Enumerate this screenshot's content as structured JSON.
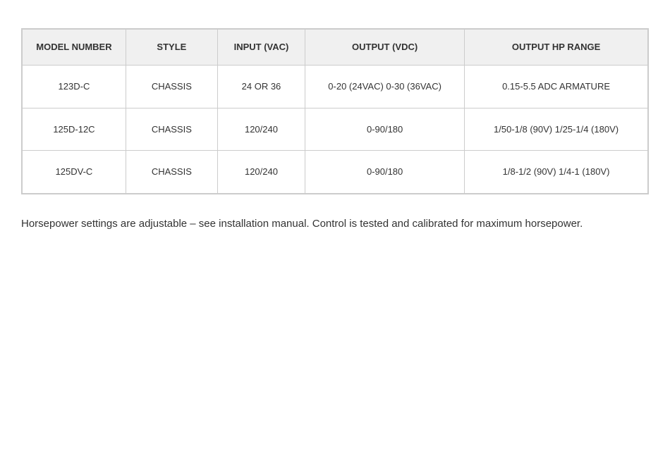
{
  "table": {
    "headers": {
      "model_number": "MODEL NUMBER",
      "style": "STYLE",
      "input_vac": "INPUT (VAC)",
      "output_vdc": "OUTPUT (VDC)",
      "output_hp_range": "OUTPUT HP RANGE"
    },
    "rows": [
      {
        "model": "123D-C",
        "style": "CHASSIS",
        "input": "24 OR 36",
        "output_vdc": "0-20 (24VAC) 0-30 (36VAC)",
        "output_hp": "0.15-5.5 ADC ARMATURE"
      },
      {
        "model": "125D-12C",
        "style": "CHASSIS",
        "input": "120/240",
        "output_vdc": "0-90/180",
        "output_hp": "1/50-1/8 (90V) 1/25-1/4 (180V)"
      },
      {
        "model": "125DV-C",
        "style": "CHASSIS",
        "input": "120/240",
        "output_vdc": "0-90/180",
        "output_hp": "1/8-1/2 (90V) 1/4-1 (180V)"
      }
    ]
  },
  "footer": {
    "text": "Horsepower settings are adjustable – see installation manual. Control is tested and calibrated for maximum horsepower."
  }
}
